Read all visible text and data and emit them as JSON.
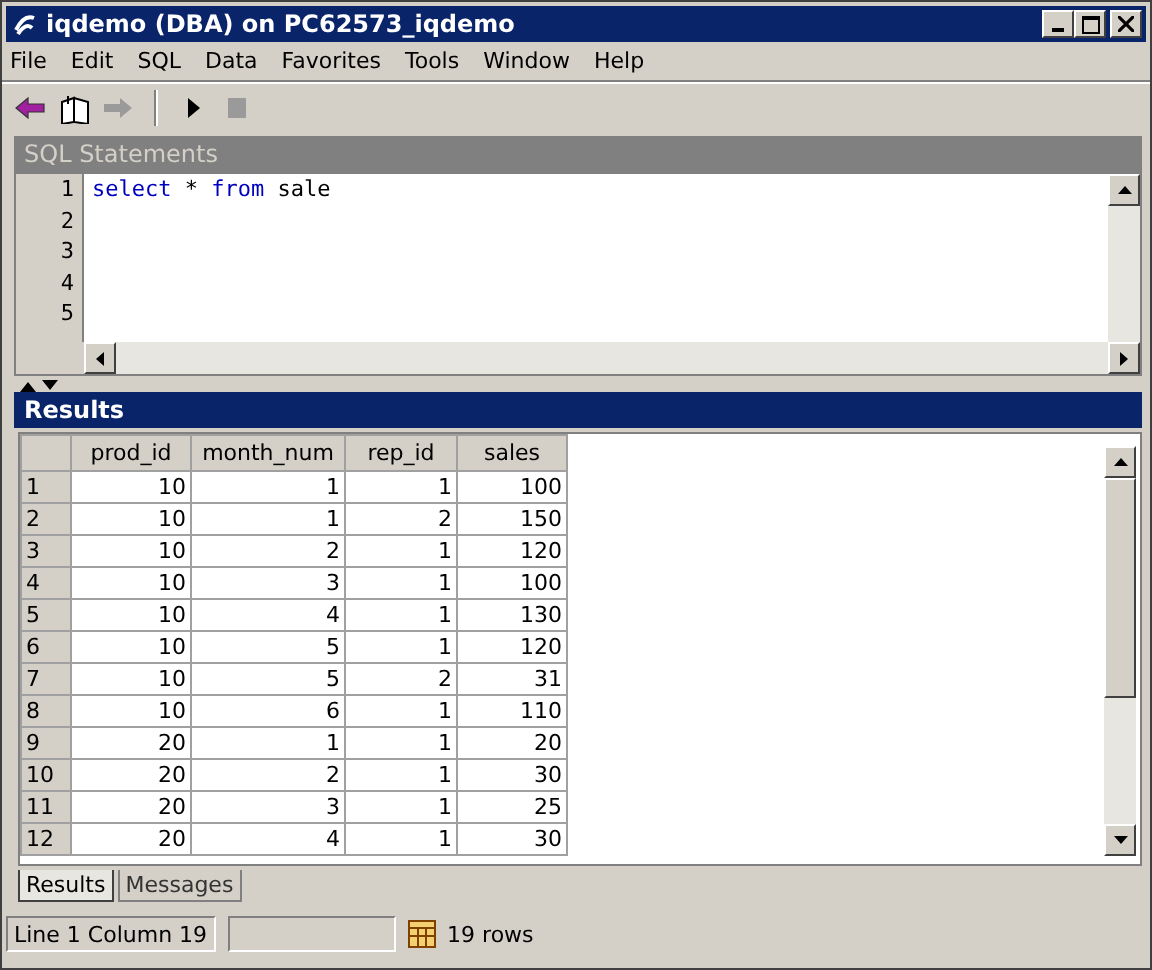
{
  "window": {
    "title": "iqdemo (DBA) on PC62573_iqdemo"
  },
  "menu": [
    "File",
    "Edit",
    "SQL",
    "Data",
    "Favorites",
    "Tools",
    "Window",
    "Help"
  ],
  "toolbar": [
    {
      "kind": "back",
      "disabled": false
    },
    {
      "kind": "book",
      "disabled": false
    },
    {
      "kind": "forward",
      "disabled": true
    },
    {
      "kind": "run",
      "disabled": false
    },
    {
      "kind": "stop",
      "disabled": true
    }
  ],
  "sql_panel": {
    "title": "SQL Statements",
    "lines": [
      {
        "number": "1",
        "tokens": [
          {
            "kind": "keyword",
            "text": "select"
          },
          {
            "kind": "plain",
            "text": " * "
          },
          {
            "kind": "keyword",
            "text": "from"
          },
          {
            "kind": "plain",
            "text": " sale"
          }
        ]
      },
      {
        "number": "2"
      },
      {
        "number": "3"
      },
      {
        "number": "4"
      },
      {
        "number": "5"
      }
    ]
  },
  "results_panel": {
    "title": "Results",
    "columns": [
      "prod_id",
      "month_num",
      "rep_id",
      "sales"
    ],
    "rows": [
      {
        "number": "1",
        "cells": [
          "10",
          "1",
          "1",
          "100"
        ]
      },
      {
        "number": "2",
        "cells": [
          "10",
          "1",
          "2",
          "150"
        ]
      },
      {
        "number": "3",
        "cells": [
          "10",
          "2",
          "1",
          "120"
        ]
      },
      {
        "number": "4",
        "cells": [
          "10",
          "3",
          "1",
          "100"
        ]
      },
      {
        "number": "5",
        "cells": [
          "10",
          "4",
          "1",
          "130"
        ]
      },
      {
        "number": "6",
        "cells": [
          "10",
          "5",
          "1",
          "120"
        ]
      },
      {
        "number": "7",
        "cells": [
          "10",
          "5",
          "2",
          "31"
        ]
      },
      {
        "number": "8",
        "cells": [
          "10",
          "6",
          "1",
          "110"
        ]
      },
      {
        "number": "9",
        "cells": [
          "20",
          "1",
          "1",
          "20"
        ]
      },
      {
        "number": "10",
        "cells": [
          "20",
          "2",
          "1",
          "30"
        ]
      },
      {
        "number": "11",
        "cells": [
          "20",
          "3",
          "1",
          "25"
        ]
      },
      {
        "number": "12",
        "cells": [
          "20",
          "4",
          "1",
          "30"
        ]
      }
    ],
    "tabs": [
      {
        "label": "Results",
        "selected": true
      },
      {
        "label": "Messages",
        "selected": false
      }
    ]
  },
  "status_bar": {
    "position": "Line 1   Column 19",
    "rows": "19 rows"
  }
}
